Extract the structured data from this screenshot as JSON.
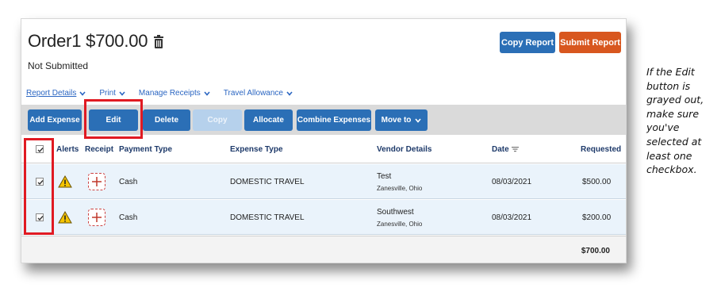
{
  "report": {
    "title": "Order1 $700.00",
    "status": "Not Submitted",
    "copy_label": "Copy Report",
    "submit_label": "Submit Report"
  },
  "menu": [
    {
      "label": "Report Details"
    },
    {
      "label": "Print"
    },
    {
      "label": "Manage Receipts"
    },
    {
      "label": "Travel Allowance"
    }
  ],
  "toolbar": {
    "add_expense": "Add Expense",
    "edit": "Edit",
    "delete": "Delete",
    "copy": "Copy",
    "allocate": "Allocate",
    "combine": "Combine Expenses",
    "move_to": "Move to"
  },
  "table": {
    "headers": {
      "alerts": "Alerts",
      "receipt": "Receipt",
      "payment_type": "Payment Type",
      "expense_type": "Expense Type",
      "vendor_details": "Vendor Details",
      "date": "Date",
      "requested": "Requested"
    },
    "rows": [
      {
        "payment_type": "Cash",
        "expense_type": "DOMESTIC TRAVEL",
        "vendor": "Test",
        "location": "Zanesville, Ohio",
        "date": "08/03/2021",
        "requested": "$500.00",
        "checked": true
      },
      {
        "payment_type": "Cash",
        "expense_type": "DOMESTIC TRAVEL",
        "vendor": "Southwest",
        "location": "Zanesville, Ohio",
        "date": "08/03/2021",
        "requested": "$200.00",
        "checked": true
      }
    ],
    "total": "$700.00"
  },
  "colors": {
    "primary_button": "#2b6fb6",
    "submit_button": "#d8571f",
    "highlight": "#e01a22",
    "row_background": "#eaf3fb",
    "warning": "#f5c400"
  },
  "icons": [
    "trash-icon",
    "chevron-down-icon",
    "checkbox-icon",
    "warning-icon",
    "add-receipt-icon",
    "sort-icon"
  ],
  "note": {
    "text": "If the Edit button is grayed out, make sure you've selected at least one checkbox."
  }
}
